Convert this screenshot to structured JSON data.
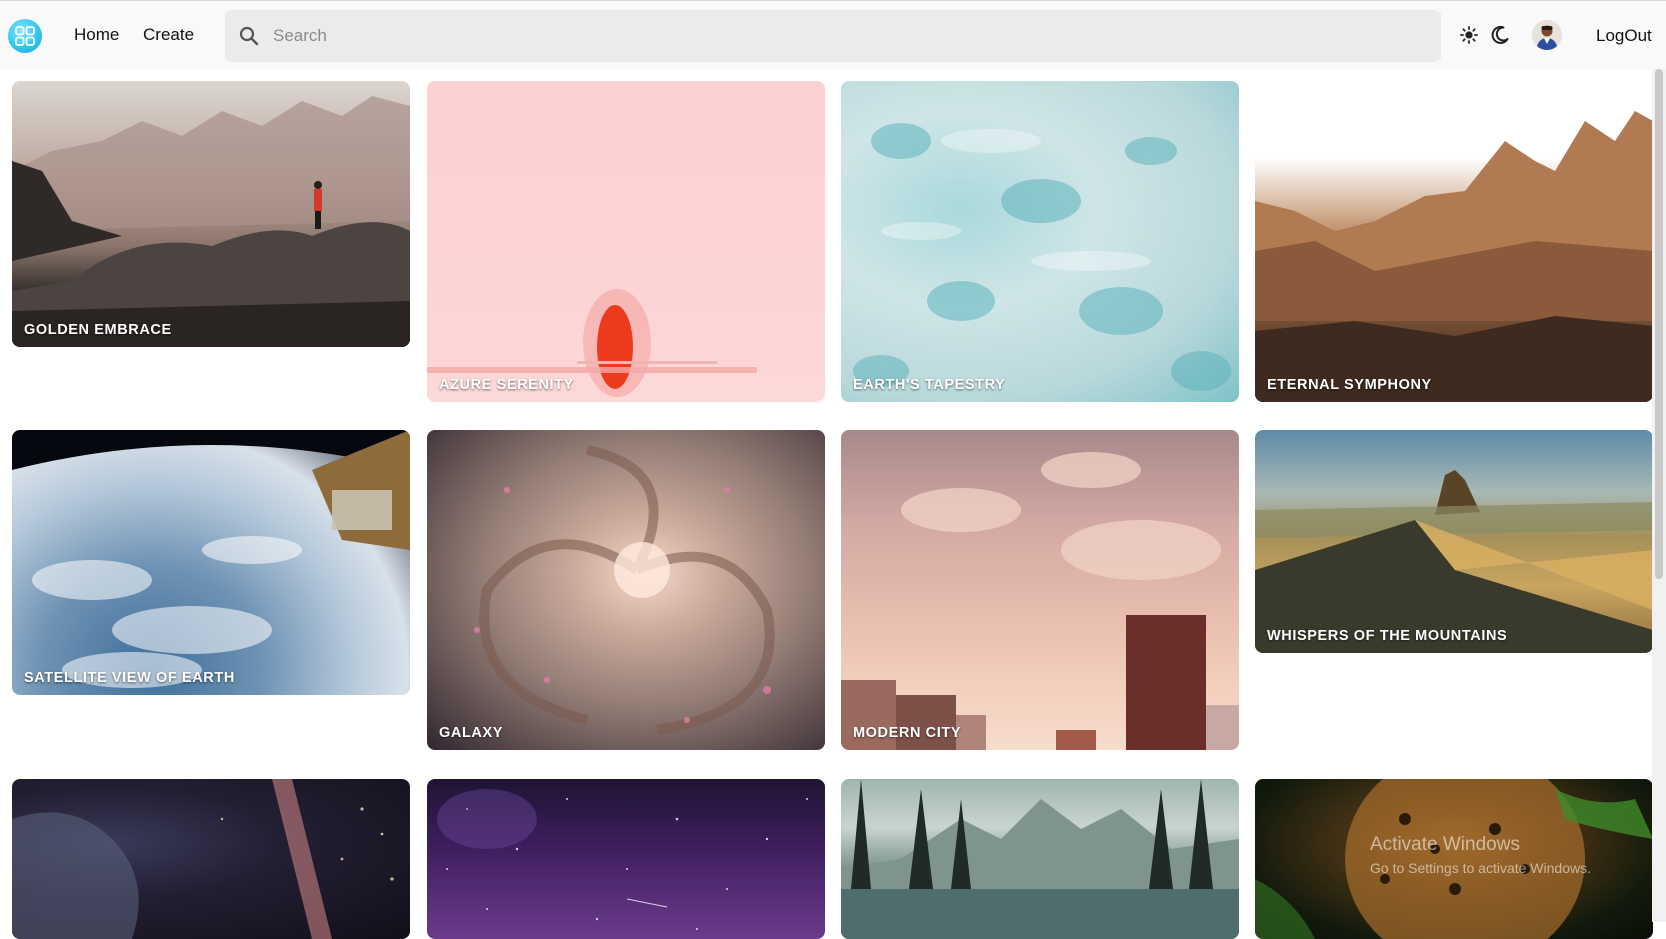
{
  "header": {
    "nav": {
      "home": "Home",
      "create": "Create"
    },
    "search": {
      "placeholder": "Search",
      "value": ""
    },
    "logout": "LogOut",
    "icons": [
      "app-logo-icon",
      "search-icon",
      "sun-icon",
      "moon-icon",
      "user-avatar"
    ]
  },
  "gallery": {
    "cards": [
      {
        "title": "GOLDEN EMBRACE"
      },
      {
        "title": "AZURE SERENITY"
      },
      {
        "title": "EARTH'S TAPESTRY"
      },
      {
        "title": "ETERNAL SYMPHONY"
      },
      {
        "title": "SATELLITE VIEW OF EARTH"
      },
      {
        "title": "GALAXY"
      },
      {
        "title": "MODERN CITY"
      },
      {
        "title": "WHISPERS OF THE MOUNTAINS"
      },
      {
        "title": ""
      },
      {
        "title": ""
      },
      {
        "title": ""
      },
      {
        "title": ""
      }
    ]
  },
  "watermark": {
    "title": "Activate Windows",
    "subtitle": "Go to Settings to activate Windows."
  },
  "colors": {
    "header_bg": "#f9f9f9",
    "search_bg": "#ebebeb",
    "logo_accent": "#33c6ee"
  }
}
